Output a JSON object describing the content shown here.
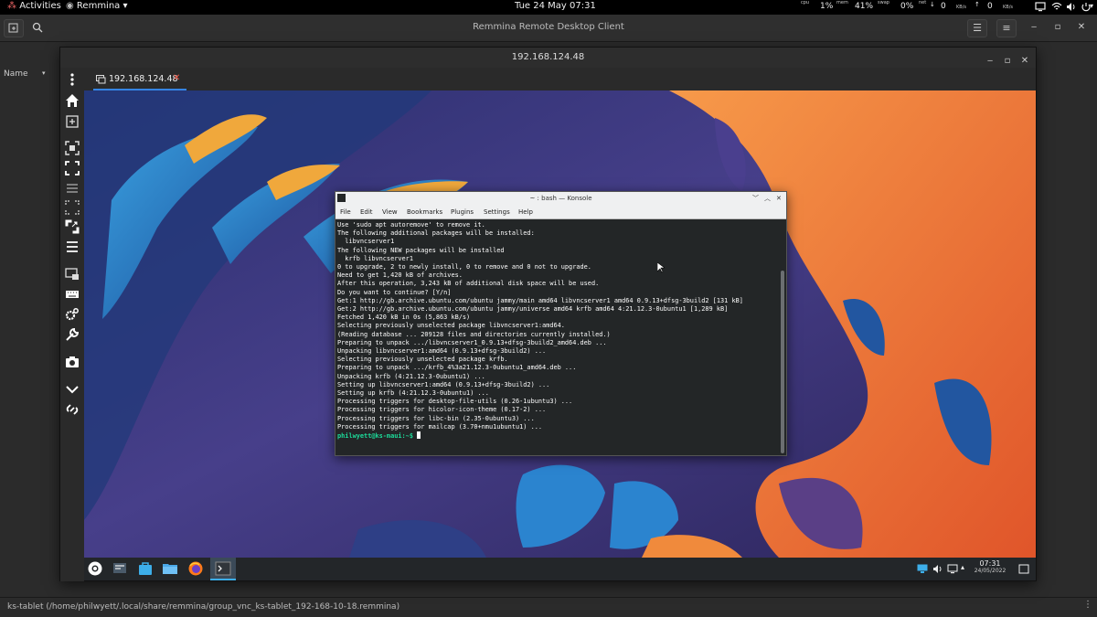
{
  "topbar": {
    "activities": "Activities",
    "app_menu": "Remmina",
    "clock": "Tue 24 May  07:31",
    "monitors": {
      "cpu_label": "cpu",
      "cpu_value": "1%",
      "mem_label": "mem",
      "mem_value": "41%",
      "swap_label": "swap",
      "swap_value": "0%",
      "net_label": "net",
      "net_down": "0",
      "net_down_unit": "KB/s",
      "net_up": "0",
      "net_up_unit": "KB/s"
    }
  },
  "remmina_main": {
    "title": "Remmina Remote Desktop Client",
    "column_name": "Name",
    "status": "ks-tablet (/home/philwyett/.local/share/remmina/group_vnc_ks-tablet_192-168-10-18.remmina)"
  },
  "connection_window": {
    "title": "192.168.124.48",
    "tab_label": "192.168.124.48"
  },
  "konsole": {
    "title": "~ : bash — Konsole",
    "menu": [
      "File",
      "Edit",
      "View",
      "Bookmarks",
      "Plugins",
      "Settings",
      "Help"
    ],
    "lines": [
      "Use 'sudo apt autoremove' to remove it.",
      "The following additional packages will be installed:",
      "  libvncserver1",
      "The following NEW packages will be installed",
      "  krfb libvncserver1",
      "0 to upgrade, 2 to newly install, 0 to remove and 0 not to upgrade.",
      "Need to get 1,420 kB of archives.",
      "After this operation, 3,243 kB of additional disk space will be used.",
      "Do you want to continue? [Y/n]",
      "Get:1 http://gb.archive.ubuntu.com/ubuntu jammy/main amd64 libvncserver1 amd64 0.9.13+dfsg-3build2 [131 kB]",
      "Get:2 http://gb.archive.ubuntu.com/ubuntu jammy/universe amd64 krfb amd64 4:21.12.3-0ubuntu1 [1,289 kB]",
      "Fetched 1,420 kB in 0s (5,863 kB/s)",
      "Selecting previously unselected package libvncserver1:amd64.",
      "(Reading database ... 209128 files and directories currently installed.)",
      "Preparing to unpack .../libvncserver1_0.9.13+dfsg-3build2_amd64.deb ...",
      "Unpacking libvncserver1:amd64 (0.9.13+dfsg-3build2) ...",
      "Selecting previously unselected package krfb.",
      "Preparing to unpack .../krfb_4%3a21.12.3-0ubuntu1_amd64.deb ...",
      "Unpacking krfb (4:21.12.3-0ubuntu1) ...",
      "Setting up libvncserver1:amd64 (0.9.13+dfsg-3build2) ...",
      "Setting up krfb (4:21.12.3-0ubuntu1) ...",
      "Processing triggers for desktop-file-utils (0.26-1ubuntu3) ...",
      "Processing triggers for hicolor-icon-theme (0.17-2) ...",
      "Processing triggers for libc-bin (2.35-0ubuntu3) ...",
      "Processing triggers for mailcap (3.70+nmu1ubuntu1) ..."
    ],
    "prompt": "philwyett@ks-maui:~$"
  },
  "kde_panel": {
    "time": "07:31",
    "date": "24/05/2022"
  }
}
